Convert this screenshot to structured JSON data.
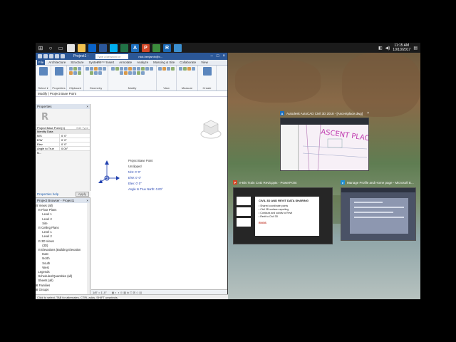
{
  "taskbar": {
    "apps": [
      {
        "name": "chrome",
        "label": "",
        "color": "#e5e5e5"
      },
      {
        "name": "explorer",
        "label": "",
        "color": "#f2c14e"
      },
      {
        "name": "outlook",
        "label": "",
        "color": "#0a63c9"
      },
      {
        "name": "word",
        "label": "",
        "color": "#2b579a"
      },
      {
        "name": "skype",
        "label": "",
        "color": "#00aff0"
      },
      {
        "name": "excel",
        "label": "",
        "color": "#217346"
      },
      {
        "name": "autodesk",
        "label": "A",
        "color": "#1c6fbf"
      },
      {
        "name": "powerpoint",
        "label": "P",
        "color": "#d24726"
      },
      {
        "name": "camtasia",
        "label": "",
        "color": "#3c8c3c"
      },
      {
        "name": "revit",
        "label": "R",
        "color": "#1b69b6"
      },
      {
        "name": "other",
        "label": "",
        "color": "#3b8fd0"
      }
    ],
    "time": "11:15 AM",
    "date": "10/10/2017"
  },
  "revit": {
    "title": "Project1 -",
    "search_placeholder": "Type a keyword or phrase",
    "user": "nick.benjamin@v...",
    "tabs": [
      "File",
      "Architecture",
      "Structure",
      "Systems",
      "Insert",
      "Annotate",
      "Analyze",
      "Massing & Site",
      "Collaborate",
      "View"
    ],
    "ribbon_panels": [
      "Select ▾",
      "Properties",
      "Clipboard",
      "Geometry",
      "Modify",
      "View",
      "Measure",
      "Create"
    ],
    "context_bar": "Modify | Project Base Point",
    "status_bar": "Click to select, TAB for alternates, CTRL adds, SHIFT unselects."
  },
  "properties": {
    "header": "Properties",
    "logo": "R",
    "type_label": "Project Base Point (1)",
    "edit_type": "Edit Type",
    "group": "Identity Data",
    "rows": [
      {
        "k": "N/S",
        "v": "0' 0\""
      },
      {
        "k": "E/W",
        "v": "0' 0\""
      },
      {
        "k": "Elev",
        "v": "0' 0\""
      },
      {
        "k": "Angle to True N...",
        "v": "0.00°"
      }
    ],
    "help_link": "Properties help",
    "apply": "Apply"
  },
  "browser": {
    "header": "Project Browser - Project1",
    "items": [
      "⊟ Views (all)",
      "   ⊟ Floor Plans",
      "        Level 1",
      "        Level 2",
      "        Site",
      "   ⊟ Ceiling Plans",
      "        Level 1",
      "        Level 2",
      "   ⊟ 3D Views",
      "        {3D}",
      "   ⊟ Elevations (Building Elevation",
      "        East",
      "        North",
      "        South",
      "        West",
      "   Legends",
      "   Schedules/Quantities (all)",
      "   Sheets (all)",
      "⊞ Families",
      "⊞ Groups"
    ]
  },
  "canvas": {
    "bp_title": "Project Base Point",
    "bp_unclip": "Unclipped",
    "ns": "N/S:  0' 0\"",
    "ew": "E/W:  0' 0\"",
    "elev": "Elev:  0' 0\"",
    "angle": "Angle to True North:  0.00°",
    "scale": "1/8\" = 1'-0\""
  },
  "taskview": {
    "cad_title": "Autodesk AutoCAD Civil 3D 2018 - [Ascentplace.dwg]",
    "cad_text": "ASCENT PLACE",
    "ppt_title": "e-Bis Train CAD Revit.pptx - PowerPoint",
    "ppt_heading": "CIVIL 3D AND REVIT DATA SHARING",
    "ppt_bullets": [
      "Shared coordinate points",
      "Civil 3D surface exporting",
      "Contours and subdiv to Revit",
      "Revit to Civil 3D"
    ],
    "ppt_footer": "ENGIS",
    "web_title": "Manage Profile and Home page - Microsoft E..."
  },
  "colors": {
    "revit_blue": "#2b5797",
    "base_point_blue": "#2040b0",
    "ascent_magenta": "#c03cb0"
  }
}
